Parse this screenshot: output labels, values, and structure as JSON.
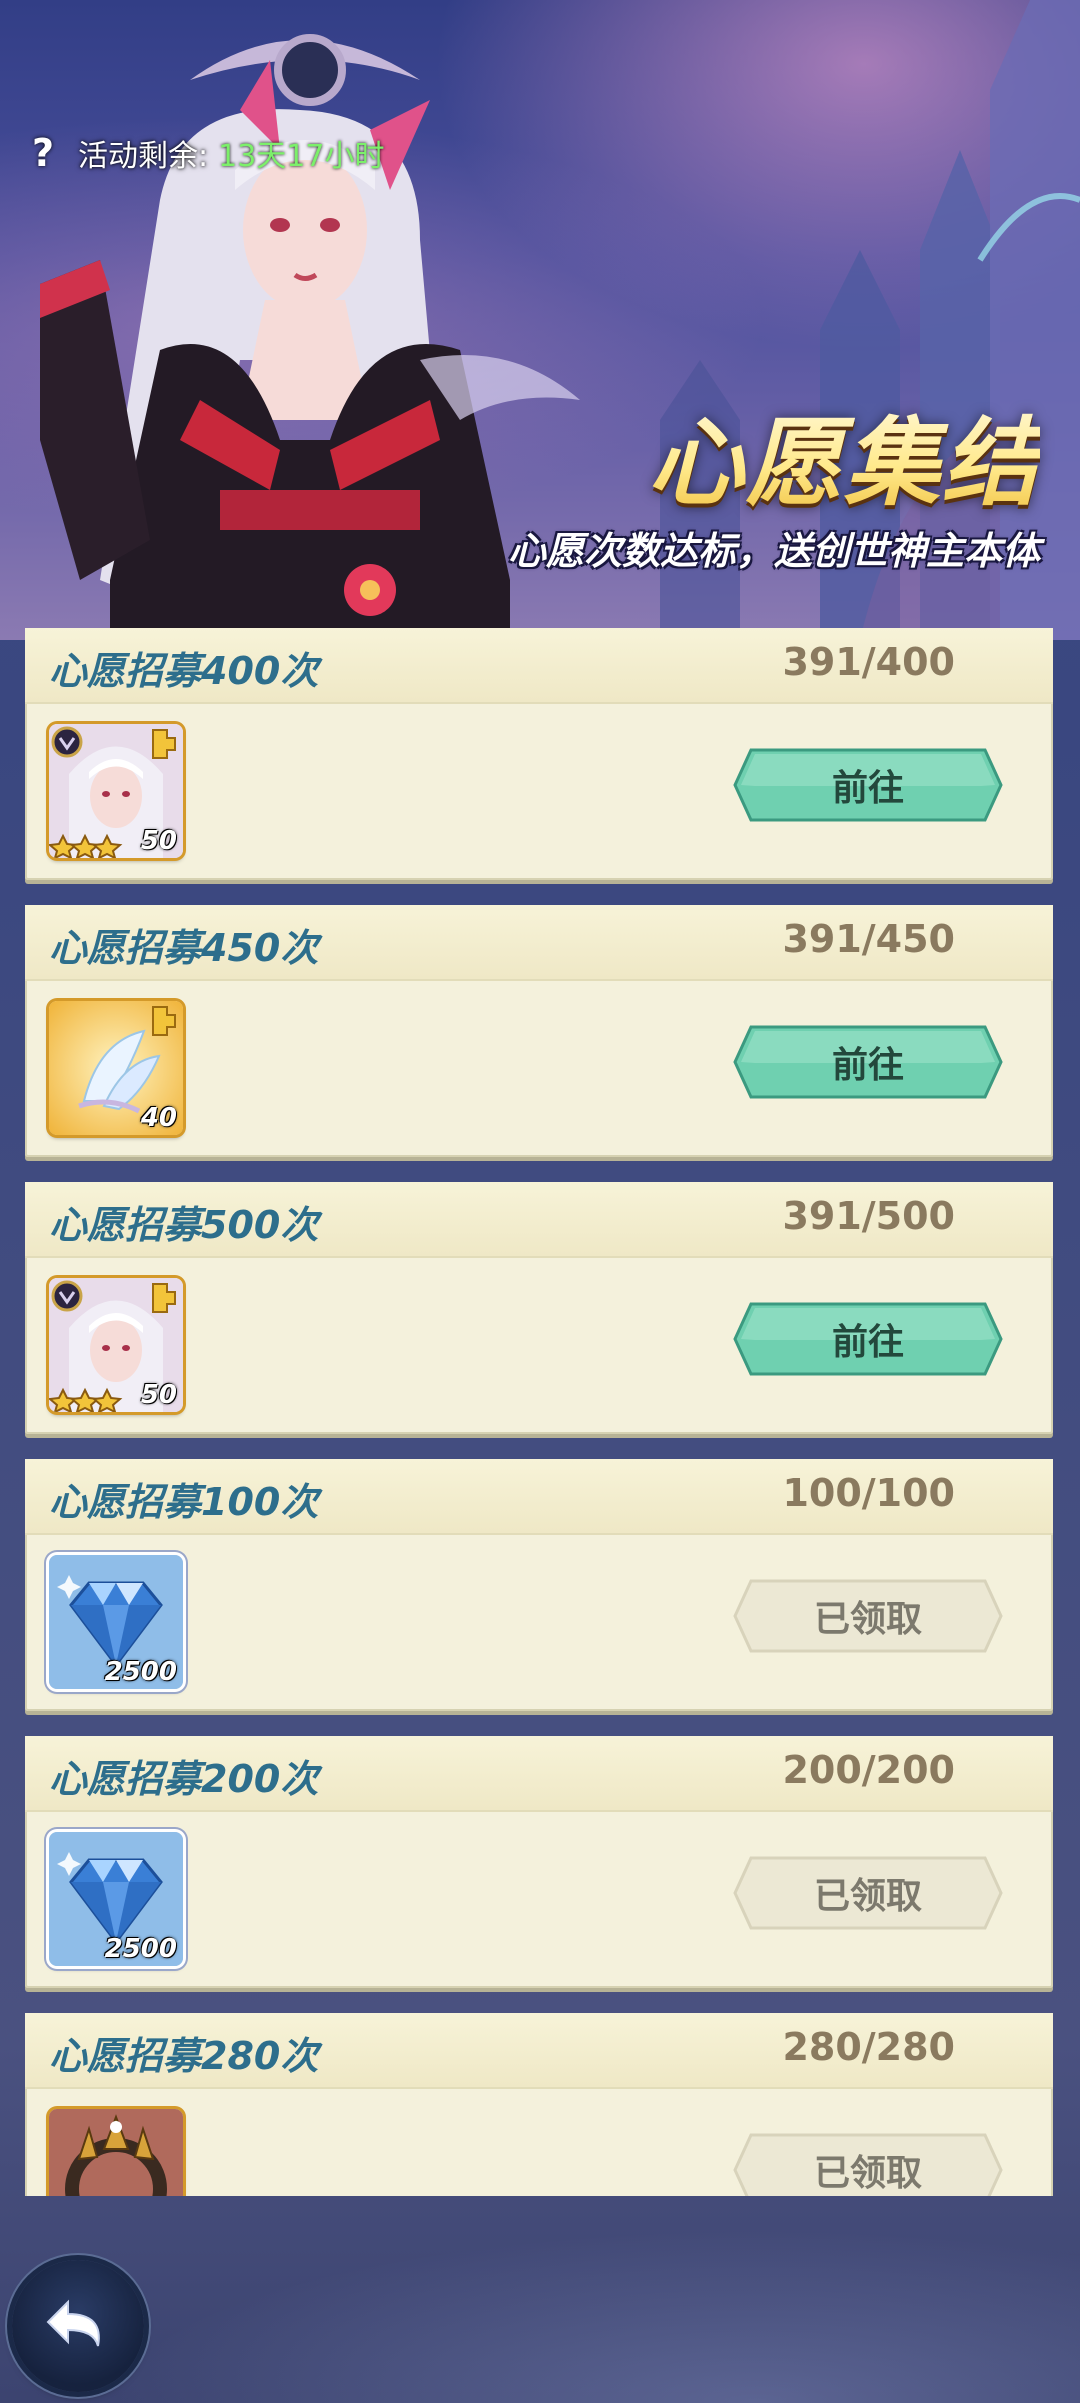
{
  "banner": {
    "timer_label": "活动剩余:",
    "timer_value": "13天17小时",
    "title": "心愿集结",
    "subtitle": "心愿次数达标，送创世神主本体"
  },
  "icons": {
    "help": "question-icon",
    "back": "back-arrow-icon"
  },
  "colors": {
    "go_button": "#6fd0b0",
    "claimed_button": "#ece8d4",
    "card_bg": "#f4f1dc",
    "title_text": "#2d6e8c",
    "progress_text": "#8a7a5f",
    "timer_value": "#7cf06a"
  },
  "tasks": [
    {
      "title": "心愿招募400次",
      "progress": "391/400",
      "reward_icon": "hero-portrait",
      "reward_qty": "50",
      "button": "前往",
      "state": "go"
    },
    {
      "title": "心愿招募450次",
      "progress": "391/450",
      "reward_icon": "crystal-feather",
      "reward_qty": "40",
      "button": "前往",
      "state": "go"
    },
    {
      "title": "心愿招募500次",
      "progress": "391/500",
      "reward_icon": "hero-portrait",
      "reward_qty": "50",
      "button": "前往",
      "state": "go"
    },
    {
      "title": "心愿招募100次",
      "progress": "100/100",
      "reward_icon": "diamond",
      "reward_qty": "2500",
      "button": "已领取",
      "state": "claimed"
    },
    {
      "title": "心愿招募200次",
      "progress": "200/200",
      "reward_icon": "diamond",
      "reward_qty": "2500",
      "button": "已领取",
      "state": "claimed"
    },
    {
      "title": "心愿招募280次",
      "progress": "280/280",
      "reward_icon": "crown-frame",
      "reward_qty": "",
      "button": "已领取",
      "state": "claimed"
    }
  ]
}
